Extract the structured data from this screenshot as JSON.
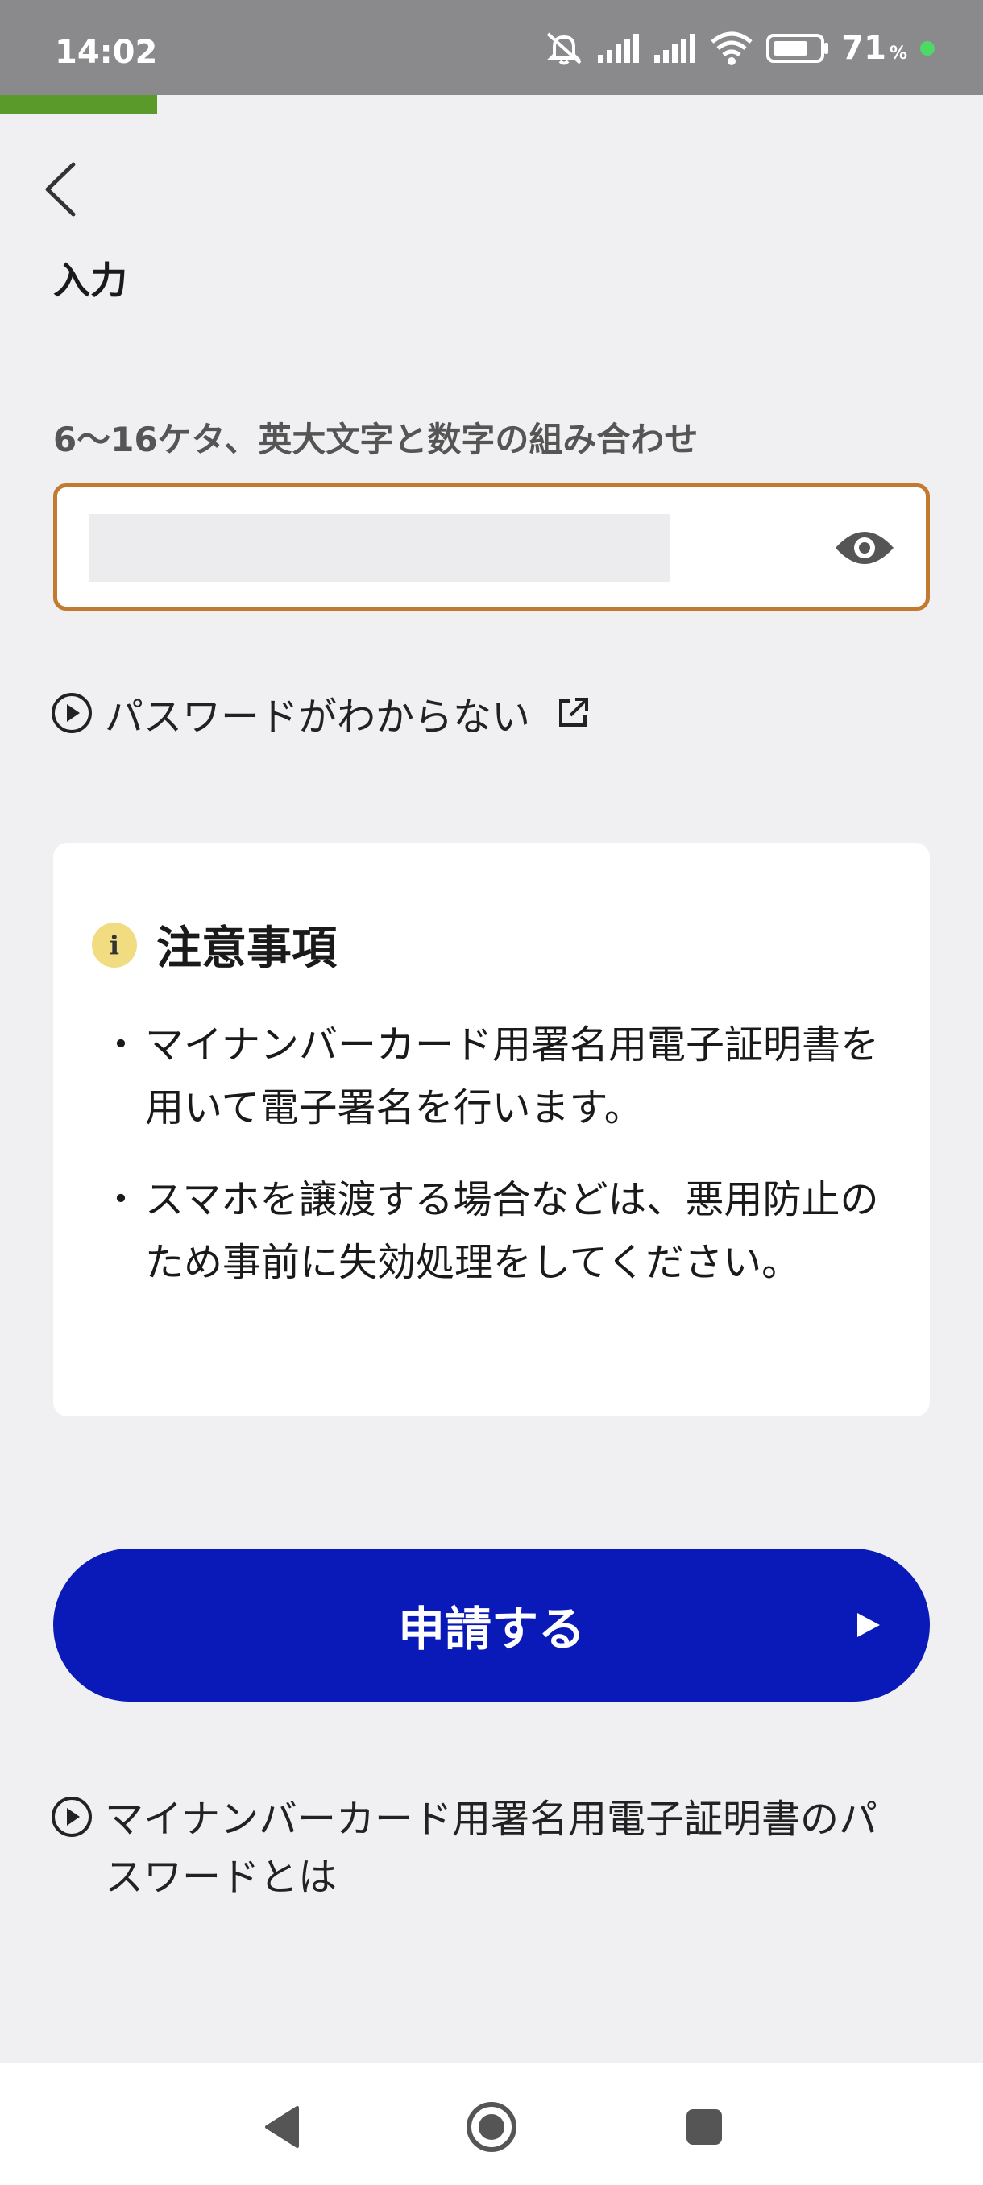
{
  "status_bar": {
    "time": "14:02",
    "battery_percent": "71",
    "battery_unit": "%",
    "icons": [
      "mute-icon",
      "signal-icon",
      "signal-icon",
      "wifi-icon",
      "battery-icon"
    ]
  },
  "progress": {
    "fraction": 0.16,
    "color": "#5a9a2a"
  },
  "header": {
    "back_icon": "chevron-left-icon"
  },
  "form": {
    "section_title": "入力",
    "hint": "6〜16ケタ、英大文字と数字の組み合わせ",
    "toggle_icon": "eye-icon",
    "forgot_link": "パスワードがわからない",
    "accent_border": "#c27a30"
  },
  "notice": {
    "title": "注意事項",
    "items": [
      "マイナンバーカード用署名用電子証明書を用いて電子署名を行います。",
      "スマホを譲渡する場合などは、悪用防止のため事前に失効処理をしてください。"
    ]
  },
  "actions": {
    "apply_label": "申請する",
    "apply_color": "#0a1ab8",
    "about_link": "マイナンバーカード用署名用電子証明書のパスワードとは"
  },
  "nav": {
    "icons": [
      "back-triangle-icon",
      "home-circle-icon",
      "recents-square-icon"
    ]
  }
}
